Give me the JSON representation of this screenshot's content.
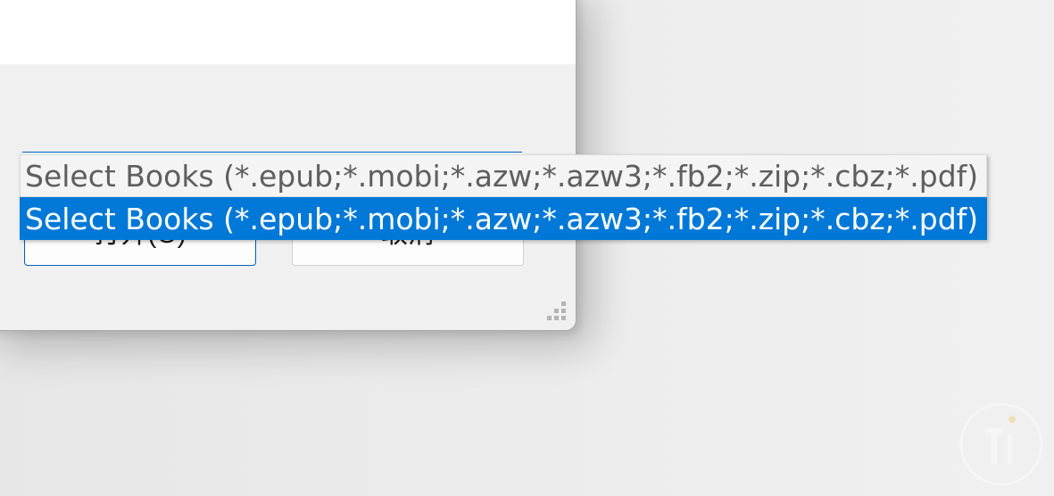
{
  "dialog": {
    "buttons": {
      "open_label": "打开(O)",
      "cancel_label": "取消"
    }
  },
  "file_type_dropdown": {
    "options": [
      {
        "label": "Select Books (*.epub;*.mobi;*.azw;*.azw3;*.fb2;*.zip;*.cbz;*.pdf)",
        "state": "normal"
      },
      {
        "label": "Select Books (*.epub;*.mobi;*.azw;*.azw3;*.fb2;*.zip;*.cbz;*.pdf)",
        "state": "selected"
      }
    ],
    "colors": {
      "selected_background": "#0078d7",
      "selected_text": "#ffffff",
      "normal_background": "#f4f4f4",
      "normal_text": "#5e5e5e"
    }
  },
  "colors": {
    "accent": "#005fb8",
    "dialog_background": "#f0f0f0"
  },
  "icons": {
    "resize_grip": "resize-grip-icon",
    "watermark": "watermark-logo-icon"
  }
}
